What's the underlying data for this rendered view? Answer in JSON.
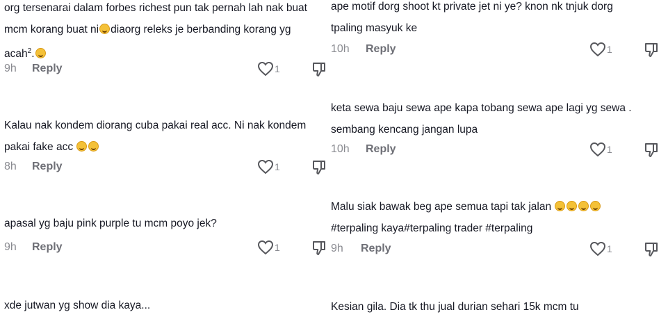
{
  "left_comments": [
    {
      "lines": [
        "org tersenarai dalam forbes richest pun tak pernah lah nak buat",
        "mcm korang buat ni",
        "diaorg releks je berbanding korang yg",
        "acah"
      ],
      "sup": "2",
      "after_sup": ".",
      "time": "9h",
      "reply": "Reply",
      "likes": "1"
    },
    {
      "lines": [
        "Kalau nak kondem diorang cuba pakai real acc. Ni nak kondem",
        "pakai fake acc"
      ],
      "time": "8h",
      "reply": "Reply",
      "likes": "1"
    },
    {
      "lines": [
        "apasal yg baju pink purple tu mcm poyo jek?"
      ],
      "time": "9h",
      "reply": "Reply",
      "likes": "1"
    },
    {
      "lines": [
        "xde jutwan yg show dia kaya..."
      ]
    }
  ],
  "right_comments": [
    {
      "lines": [
        "ape motif dorg shoot kt private jet ni ye? knon nk tnjuk dorg",
        "tpaling masyuk ke"
      ],
      "time": "10h",
      "reply": "Reply",
      "likes": "1"
    },
    {
      "lines": [
        "keta sewa baju sewa ape kapa tobang sewa ape lagi yg sewa .",
        "sembang kencang jangan lupa"
      ],
      "time": "10h",
      "reply": "Reply",
      "likes": "1"
    },
    {
      "lines": [
        "Malu siak bawak beg ape semua tapi tak jalan",
        "#terpaling kaya#terpaling trader #terpaling"
      ],
      "time": "9h",
      "reply": "Reply",
      "likes": "1"
    },
    {
      "lines": [
        "Kesian gila. Dia tk thu jual durian sehari 15k mcm tu"
      ]
    }
  ],
  "icons": {
    "emoji": "grinning-sweat-emoji",
    "like": "heart-outline-icon",
    "dislike": "thumbs-down-icon"
  }
}
